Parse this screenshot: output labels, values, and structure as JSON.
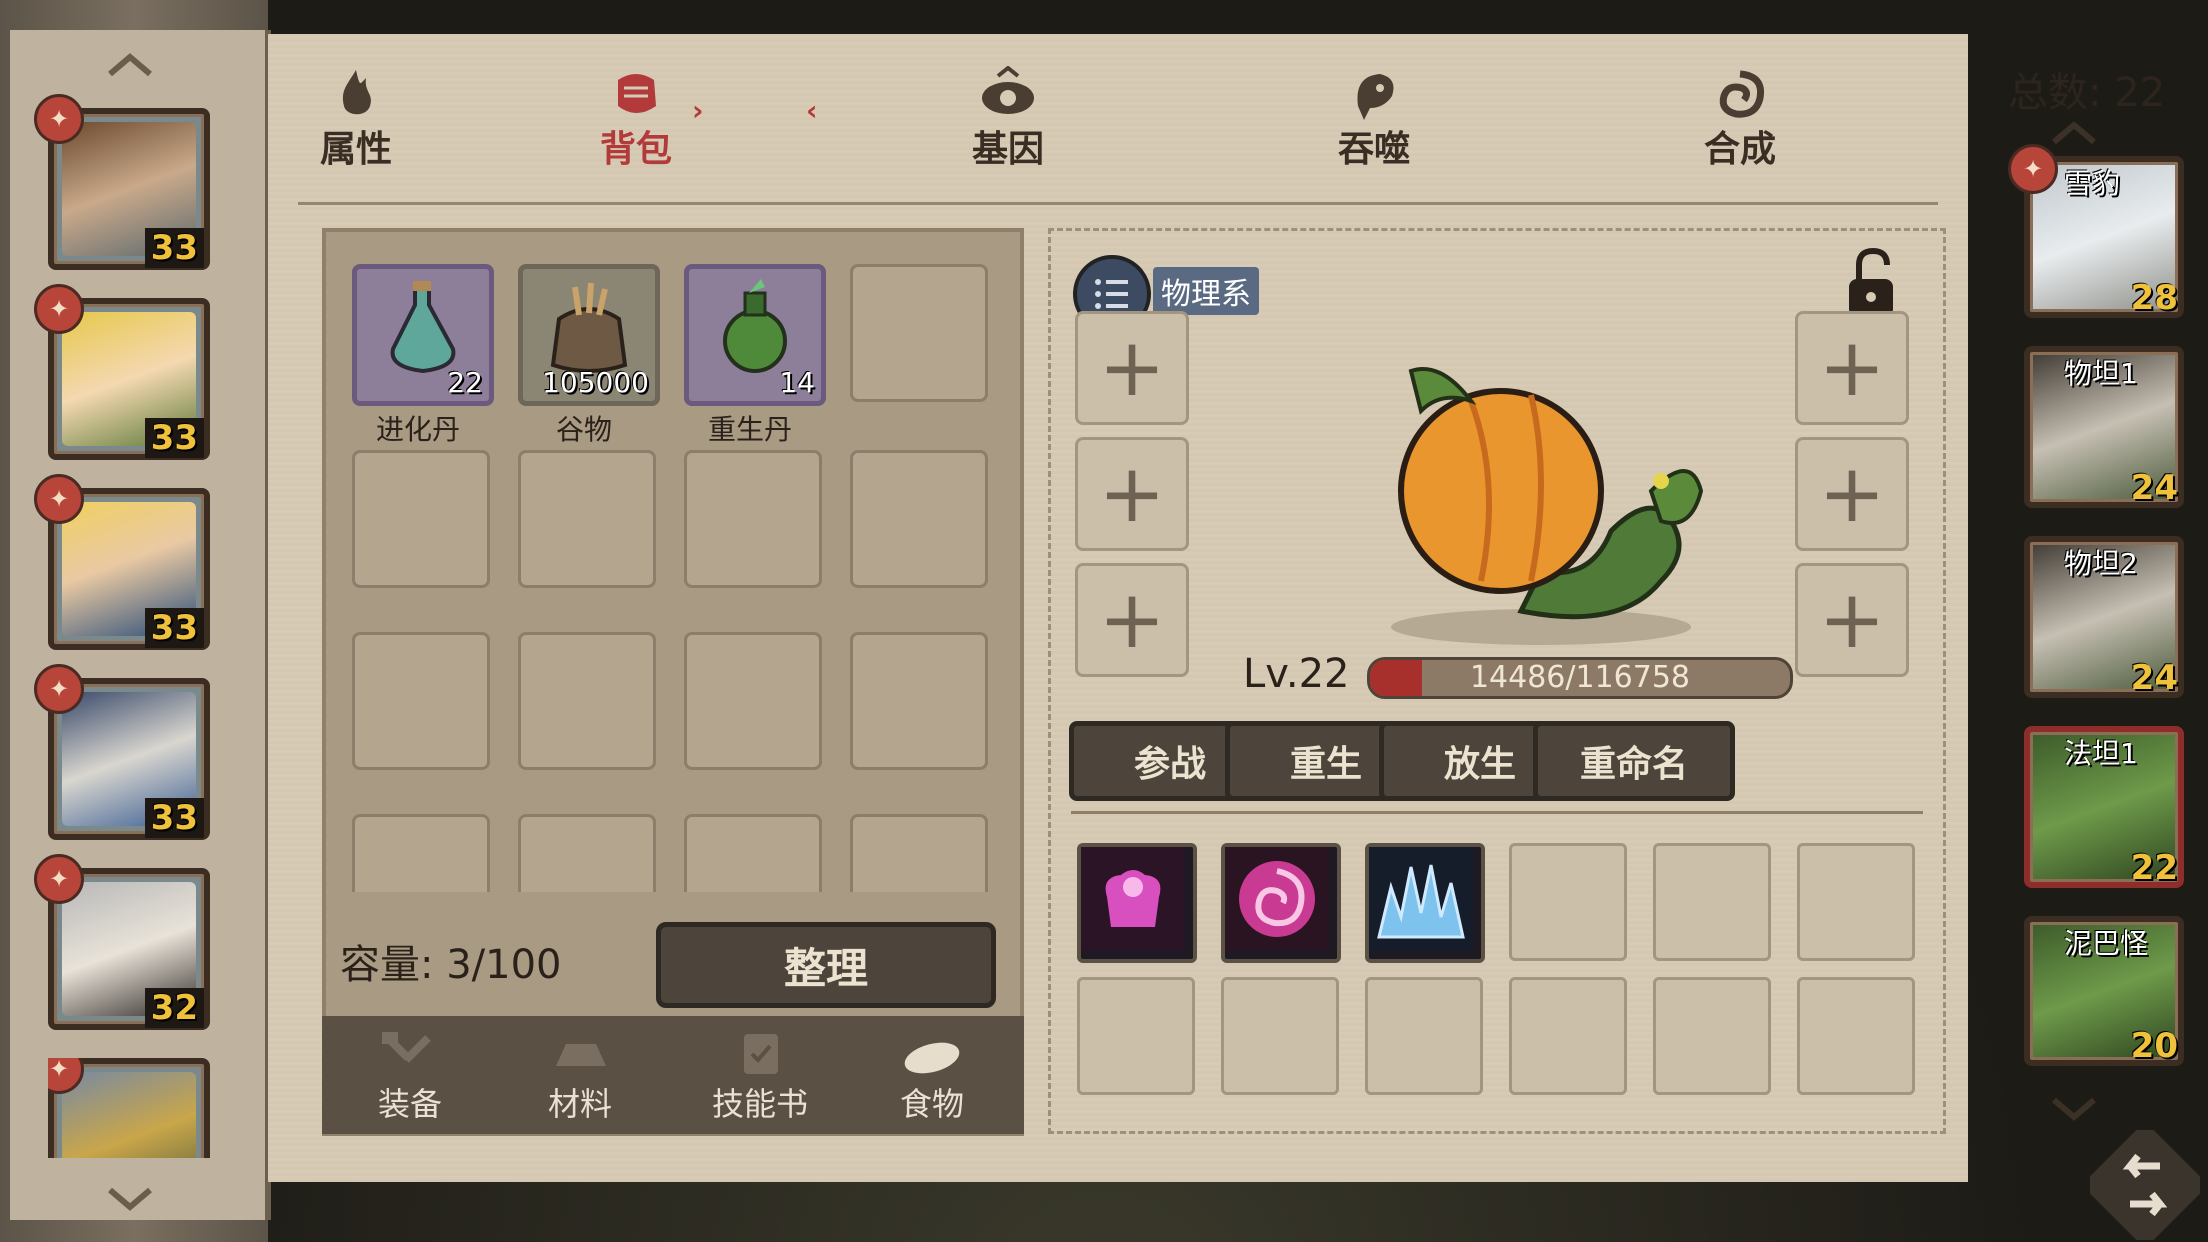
{
  "tabs": [
    {
      "label": "属性",
      "icon": "flame-icon"
    },
    {
      "label": "背包",
      "icon": "fist-icon",
      "active": true
    },
    {
      "label": "基因",
      "icon": "eye-swirl-icon"
    },
    {
      "label": "吞噬",
      "icon": "dragon-head-icon"
    },
    {
      "label": "合成",
      "icon": "spiral-beast-icon"
    }
  ],
  "active_tab_deco_left": "›",
  "active_tab_deco_right": "‹",
  "total": "总数: 22",
  "heroes": [
    {
      "level": "33",
      "badge": "✦"
    },
    {
      "level": "33",
      "badge": "✦"
    },
    {
      "level": "33",
      "badge": "✦"
    },
    {
      "level": "33",
      "badge": "✦"
    },
    {
      "level": "32",
      "badge": "✦"
    },
    {
      "level": "",
      "badge": "✦"
    }
  ],
  "inventory": {
    "items": [
      {
        "name": "进化丹",
        "count": "22",
        "icon": "potion-icon"
      },
      {
        "name": "谷物",
        "count": "105000",
        "icon": "grain-sack-icon"
      },
      {
        "name": "重生丹",
        "count": "14",
        "icon": "green-potion-icon"
      }
    ],
    "capacity": "容量: 3/100",
    "sort_label": "整理",
    "categories": [
      {
        "label": "装备",
        "icon": "hammer-icon"
      },
      {
        "label": "材料",
        "icon": "ingot-icon"
      },
      {
        "label": "技能书",
        "icon": "scroll-icon"
      },
      {
        "label": "食物",
        "icon": "bread-icon"
      }
    ]
  },
  "pet": {
    "type": "物理系",
    "level": "Lv.22",
    "exp_text": "14486/116758",
    "exp_fraction": 0.124,
    "plus": "+",
    "actions": [
      "参战",
      "重生",
      "放生",
      "重命名"
    ],
    "skills": [
      {
        "icon": "muscle-skill-icon",
        "color": "#c84ab0"
      },
      {
        "icon": "vortex-skill-icon",
        "color": "#d23a9a"
      },
      {
        "icon": "ice-spike-skill-icon",
        "color": "#6ab0e0"
      }
    ]
  },
  "pet_list": [
    {
      "name": "雪豹",
      "level": "28"
    },
    {
      "name": "物坦1",
      "level": "24"
    },
    {
      "name": "物坦2",
      "level": "24"
    },
    {
      "name": "法坦1",
      "level": "22",
      "active": true
    },
    {
      "name": "泥巴怪",
      "level": "20"
    }
  ],
  "colors": {
    "accent_red": "#b23a3a",
    "parchment": "#d7cbb5",
    "button": "#4d453c"
  }
}
